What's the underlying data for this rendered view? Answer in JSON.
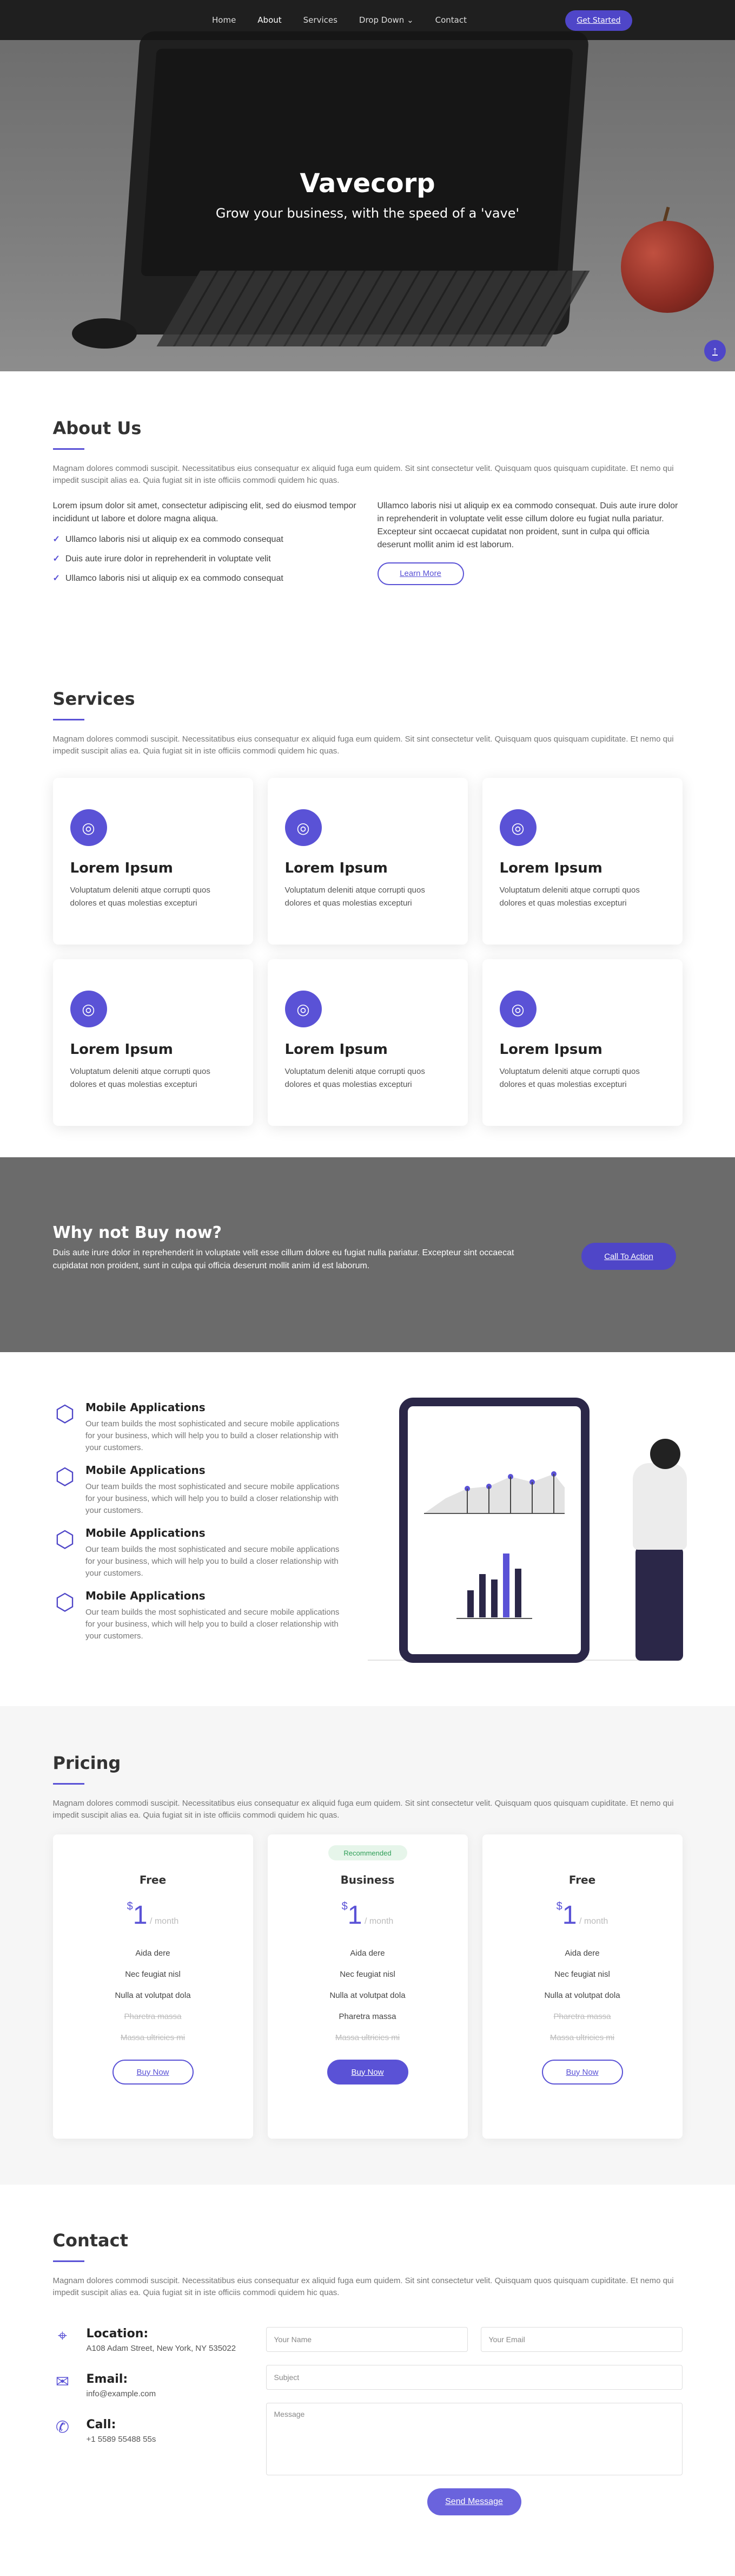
{
  "nav": {
    "items": [
      "Home",
      "About",
      "Services",
      "Drop Down",
      "Contact"
    ],
    "dropdown_caret": "⌄",
    "cta": "Get Started",
    "active": "About"
  },
  "hero": {
    "title": "Vavecorp",
    "subtitle": "Grow your business, with the speed of a 'vave'"
  },
  "about": {
    "title": "About Us",
    "desc": "Magnam dolores commodi suscipit. Necessitatibus eius consequatur ex aliquid fuga eum quidem. Sit sint consectetur velit. Quisquam quos quisquam cupiditate. Et nemo qui impedit suscipit alias ea. Quia fugiat sit in iste officiis commodi quidem hic quas.",
    "left_text": "Lorem ipsum dolor sit amet, consectetur adipiscing elit, sed do eiusmod tempor incididunt ut labore et dolore magna aliqua.",
    "bullets": [
      "Ullamco laboris nisi ut aliquip ex ea commodo consequat",
      "Duis aute irure dolor in reprehenderit in voluptate velit",
      "Ullamco laboris nisi ut aliquip ex ea commodo consequat"
    ],
    "right_text": "Ullamco laboris nisi ut aliquip ex ea commodo consequat. Duis aute irure dolor in reprehenderit in voluptate velit esse cillum dolore eu fugiat nulla pariatur. Excepteur sint occaecat cupidatat non proident, sunt in culpa qui officia deserunt mollit anim id est laborum.",
    "button": "Learn More"
  },
  "services": {
    "title": "Services",
    "desc": "Magnam dolores commodi suscipit. Necessitatibus eius consequatur ex aliquid fuga eum quidem. Sit sint consectetur velit. Quisquam quos quisquam cupiditate. Et nemo qui impedit suscipit alias ea. Quia fugiat sit in iste officiis commodi quidem hic quas.",
    "cards": [
      {
        "title": "Lorem Ipsum",
        "desc": "Voluptatum deleniti atque corrupti quos dolores et quas molestias excepturi",
        "icon": "dribbble-icon"
      },
      {
        "title": "Lorem Ipsum",
        "desc": "Voluptatum deleniti atque corrupti quos dolores et quas molestias excepturi",
        "icon": "dribbble-icon"
      },
      {
        "title": "Lorem Ipsum",
        "desc": "Voluptatum deleniti atque corrupti quos dolores et quas molestias excepturi",
        "icon": "dribbble-icon"
      },
      {
        "title": "Lorem Ipsum",
        "desc": "Voluptatum deleniti atque corrupti quos dolores et quas molestias excepturi",
        "icon": "dribbble-icon"
      },
      {
        "title": "Lorem Ipsum",
        "desc": "Voluptatum deleniti atque corrupti quos dolores et quas molestias excepturi",
        "icon": "dribbble-icon"
      },
      {
        "title": "Lorem Ipsum",
        "desc": "Voluptatum deleniti atque corrupti quos dolores et quas molestias excepturi",
        "icon": "dribbble-icon"
      }
    ]
  },
  "cta": {
    "title": "Why not Buy now?",
    "text": "Duis aute irure dolor in reprehenderit in voluptate velit esse cillum dolore eu fugiat nulla pariatur. Excepteur sint occaecat cupidatat non proident, sunt in culpa qui officia deserunt mollit anim id est laborum.",
    "button": "Call To Action"
  },
  "features": {
    "items": [
      {
        "title": "Mobile Applications",
        "desc": "Our team builds the most sophisticated and secure mobile applications for your business, which will help you to build a closer relationship with your customers."
      },
      {
        "title": "Mobile Applications",
        "desc": "Our team builds the most sophisticated and secure mobile applications for your business, which will help you to build a closer relationship with your customers."
      },
      {
        "title": "Mobile Applications",
        "desc": "Our team builds the most sophisticated and secure mobile applications for your business, which will help you to build a closer relationship with your customers."
      },
      {
        "title": "Mobile Applications",
        "desc": "Our team builds the most sophisticated and secure mobile applications for your business, which will help you to build a closer relationship with your customers."
      }
    ]
  },
  "pricing": {
    "title": "Pricing",
    "desc": "Magnam dolores commodi suscipit. Necessitatibus eius consequatur ex aliquid fuga eum quidem. Sit sint consectetur velit. Quisquam quos quisquam cupiditate. Et nemo qui impedit suscipit alias ea. Quia fugiat sit in iste officiis commodi quidem hic quas.",
    "plans": [
      {
        "name": "Free",
        "currency": "$",
        "amount": "1",
        "period": "/ month",
        "features": [
          "Aida dere",
          "Nec feugiat nisl",
          "Nulla at volutpat dola",
          "Pharetra massa",
          "Massa ultricies mi"
        ],
        "button": "Buy Now"
      },
      {
        "name": "Business",
        "badge": "Recommended",
        "currency": "$",
        "amount": "1",
        "period": "/ month",
        "features": [
          "Aida dere",
          "Nec feugiat nisl",
          "Nulla at volutpat dola",
          "Pharetra massa",
          "Massa ultricies mi"
        ],
        "button": "Buy Now"
      },
      {
        "name": "Free",
        "currency": "$",
        "amount": "1",
        "period": "/ month",
        "features": [
          "Aida dere",
          "Nec feugiat nisl",
          "Nulla at volutpat dola",
          "Pharetra massa",
          "Massa ultricies mi"
        ],
        "button": "Buy Now"
      }
    ]
  },
  "contact": {
    "title": "Contact",
    "desc": "Magnam dolores commodi suscipit. Necessitatibus eius consequatur ex aliquid fuga eum quidem. Sit sint consectetur velit. Quisquam quos quisquam cupiditate. Et nemo qui impedit suscipit alias ea. Quia fugiat sit in iste officiis commodi quidem hic quas.",
    "info": [
      {
        "title": "Location:",
        "text": "A108 Adam Street, New York, NY 535022",
        "icon": "map-pin-icon"
      },
      {
        "title": "Email:",
        "text": "info@example.com",
        "icon": "envelope-icon"
      },
      {
        "title": "Call:",
        "text": "+1 5589 55488 55s",
        "icon": "phone-icon"
      }
    ],
    "form": {
      "name_placeholder": "Your Name",
      "email_placeholder": "Your Email",
      "subject_placeholder": "Subject",
      "message_placeholder": "Message",
      "send": "Send Message"
    }
  },
  "colors": {
    "accent": "#5a52d6",
    "nav_bg": "#141414",
    "cta_bg": "#6b6b6b"
  }
}
